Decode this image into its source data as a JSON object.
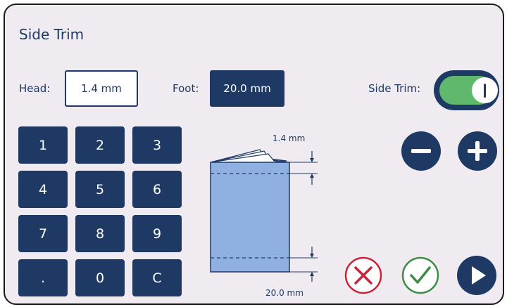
{
  "title": "Side Trim",
  "head": {
    "label": "Head:",
    "value": "1.4 mm"
  },
  "foot": {
    "label": "Foot:",
    "value": "20.0 mm"
  },
  "side_trim": {
    "label": "Side Trim:",
    "enabled": true
  },
  "keypad": {
    "keys": [
      "1",
      "2",
      "3",
      "4",
      "5",
      "6",
      "7",
      "8",
      "9",
      ".",
      "0",
      "C"
    ]
  },
  "diagram": {
    "top_measure": "1.4 mm",
    "bottom_measure": "20.0 mm"
  },
  "actions": {
    "decrement_icon": "minus-icon",
    "increment_icon": "plus-icon",
    "cancel_icon": "x-circle-icon",
    "confirm_icon": "check-circle-icon",
    "run_icon": "play-icon"
  },
  "colors": {
    "navy": "#1e3a64",
    "panel": "#efebf1",
    "toggle_on": "#5fb86c",
    "cancel": "#c8243a",
    "confirm": "#3e8b48",
    "booklet": "#8fb0e1"
  }
}
